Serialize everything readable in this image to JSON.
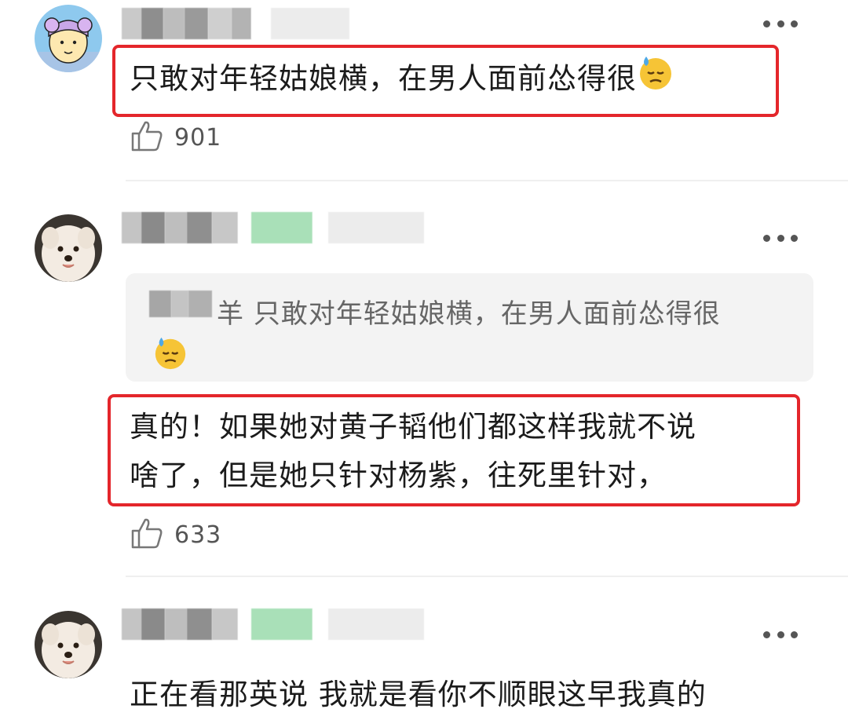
{
  "comments": [
    {
      "text": "只敢对年轻姑娘横，在男人面前怂得很",
      "emoji": "downcast-sweat-face",
      "likes": "901"
    },
    {
      "quote_author_tail": "羊",
      "quote_text": "只敢对年轻姑娘横，在男人面前怂得很",
      "quote_emoji": "downcast-sweat-face",
      "text_line1": "真的！如果她对黄子韬他们都这样我就不说",
      "text_line2": "啥了，但是她只针对杨紫，往死里针对，",
      "likes": "633"
    },
    {
      "text": "正在看那英说 我就是看你不顺眼这早我真的"
    }
  ],
  "colors": {
    "highlight_border": "#e4262b",
    "quote_bg": "#f3f3f3",
    "divider": "#efefef",
    "text": "#1b1b1b",
    "muted": "#555555"
  }
}
